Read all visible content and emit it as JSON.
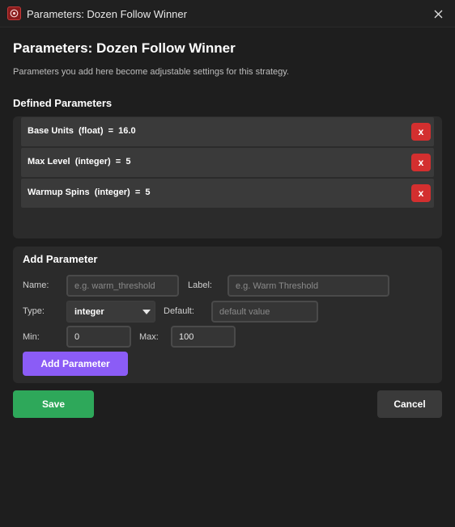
{
  "window": {
    "title": "Parameters: Dozen Follow Winner"
  },
  "header": {
    "title": "Parameters: Dozen Follow Winner",
    "description": "Parameters you add here become adjustable settings for this strategy."
  },
  "defined": {
    "section_title": "Defined Parameters",
    "remove_label": "x",
    "items": [
      {
        "label": "Base Units  (float)  =  16.0"
      },
      {
        "label": "Max Level  (integer)  =  5"
      },
      {
        "label": "Warmup Spins  (integer)  =  5"
      }
    ]
  },
  "add_form": {
    "title": "Add Parameter",
    "name_label": "Name:",
    "name_placeholder": "e.g. warm_threshold",
    "label_label": "Label:",
    "label_placeholder": "e.g. Warm Threshold",
    "type_label": "Type:",
    "type_value": "integer",
    "default_label": "Default:",
    "default_placeholder": "default value",
    "min_label": "Min:",
    "min_value": "0",
    "max_label": "Max:",
    "max_value": "100",
    "add_button": "Add Parameter"
  },
  "footer": {
    "save_button": "Save",
    "cancel_button": "Cancel"
  },
  "icons": {
    "app": "app-logo-icon",
    "close": "close-icon",
    "dropdown": "chevron-down-icon"
  },
  "colors": {
    "background": "#1e1e1e",
    "panel": "#2b2b2b",
    "remove": "#d32f2f",
    "primary": "#8b5cf6",
    "save": "#2ea85a"
  }
}
